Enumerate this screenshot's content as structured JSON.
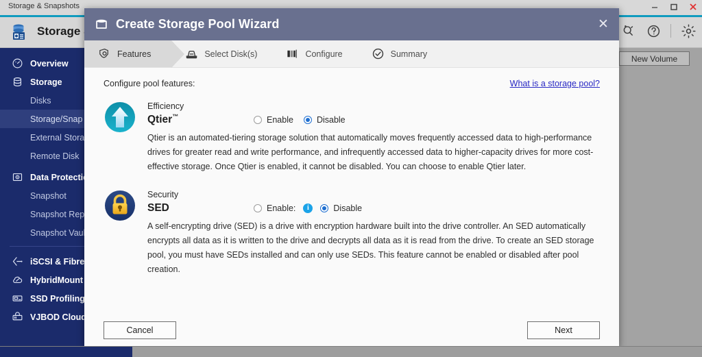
{
  "os_window": {
    "title": "Storage & Snapshots",
    "minimize_icon": "minimize-icon",
    "maximize_icon": "maximize-icon",
    "close_icon": "close-icon"
  },
  "app_header": {
    "brand": "Storage & S",
    "brand_icon": "storage-snapshots-icon",
    "tools": [
      {
        "name": "search-plus-icon",
        "glyph": "search-plus"
      },
      {
        "name": "help-icon",
        "glyph": "question-circle"
      },
      {
        "name": "settings-icon",
        "glyph": "gear"
      }
    ]
  },
  "sidebar": {
    "items": [
      {
        "label": "Overview",
        "icon": "gauge-icon",
        "type": "top"
      },
      {
        "label": "Storage",
        "icon": "database-icon",
        "type": "top"
      },
      {
        "label": "Disks",
        "type": "sub"
      },
      {
        "label": "Storage/Snap",
        "type": "sub",
        "active": true
      },
      {
        "label": "External Stora",
        "type": "sub"
      },
      {
        "label": "Remote Disk",
        "type": "sub"
      },
      {
        "label": "Data Protectio",
        "icon": "shield-camera-icon",
        "type": "top"
      },
      {
        "label": "Snapshot",
        "type": "sub"
      },
      {
        "label": "Snapshot Repl",
        "type": "sub"
      },
      {
        "label": "Snapshot Vaul",
        "type": "sub"
      },
      {
        "label": "iSCSI & Fibre (",
        "icon": "iscsi-icon",
        "type": "top",
        "divider_before": true
      },
      {
        "label": "HybridMount",
        "icon": "hybridmount-icon",
        "type": "top"
      },
      {
        "label": "SSD Profiling ",
        "icon": "ssd-icon",
        "type": "top"
      },
      {
        "label": "VJBOD Cloud ",
        "icon": "vjbod-cloud-icon",
        "type": "top"
      }
    ]
  },
  "content": {
    "new_volume_label": "New Volume"
  },
  "dialog": {
    "title": "Create Storage Pool Wizard",
    "title_icon": "storage-pool-icon",
    "close_label": "✕",
    "steps": [
      {
        "label": "Features",
        "icon": "gear-octagon-icon",
        "active": true
      },
      {
        "label": "Select Disk(s)",
        "icon": "disk-icon",
        "active": false
      },
      {
        "label": "Configure",
        "icon": "configure-bars-icon",
        "active": false
      },
      {
        "label": "Summary",
        "icon": "check-circle-icon",
        "active": false
      }
    ],
    "body_label": "Configure pool features:",
    "help_link": "What is a storage pool?",
    "features": [
      {
        "category": "Efficiency",
        "name": "Qtier",
        "trademark": "™",
        "icon": "qtier-arrow-icon",
        "options": [
          {
            "label": "Enable",
            "selected": false
          },
          {
            "label": "Disable",
            "selected": true
          }
        ],
        "has_info_icon": false,
        "description": "Qtier is an automated-tiering storage solution that automatically moves frequently accessed data to high-performance drives for greater read and write performance, and infrequently accessed data to higher-capacity drives for more cost-effective storage. Once Qtier is enabled, it cannot be disabled. You can choose to enable Qtier later."
      },
      {
        "category": "Security",
        "name": "SED",
        "trademark": "",
        "icon": "sed-lock-icon",
        "options": [
          {
            "label": "Enable:",
            "selected": false
          },
          {
            "label": "Disable",
            "selected": true
          }
        ],
        "has_info_icon": true,
        "info_icon_glyph": "i",
        "description": "A self-encrypting drive (SED) is a drive with encryption hardware built into the drive controller. An SED automatically encrypts all data as it is written to the drive and decrypts all data as it is read from the drive. To create an SED storage pool, you must have SEDs installed and can only use SEDs. This feature cannot be enabled or disabled after pool creation."
      }
    ],
    "footer": {
      "cancel_label": "Cancel",
      "next_label": "Next"
    }
  },
  "colors": {
    "sidebar_bg": "#1b2b6b",
    "sidebar_active": "#2f3f7d",
    "dialog_header": "#69708f",
    "accent_bar": "#0f9bbf",
    "link": "#2929c4",
    "radio_selected": "#1f6fd0",
    "info_icon": "#1ba3e8"
  }
}
